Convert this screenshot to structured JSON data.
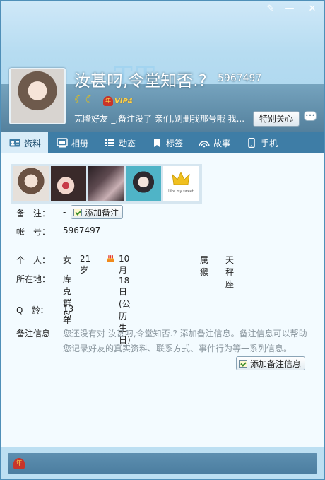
{
  "profile": {
    "nickname": "汝甚叼,令堂知否.?",
    "qq_number": "5967497",
    "header_decoration": "TT",
    "moons": "☾☾",
    "vip_label": "VIP4",
    "vip_badge": "年",
    "signature": "克隆好友-_,备注没了   亲们,别删我那号哦  我...",
    "special_care_label": "特别关心",
    "chat_icon": "chat-bubble-icon"
  },
  "window": {
    "skin_icon": "✎",
    "minimize_icon": "—",
    "close_icon": "✕"
  },
  "tabs": [
    {
      "label": "资料",
      "icon": "profile-card-icon"
    },
    {
      "label": "相册",
      "icon": "album-icon"
    },
    {
      "label": "动态",
      "icon": "list-icon"
    },
    {
      "label": "标签",
      "icon": "bookmark-icon"
    },
    {
      "label": "故事",
      "icon": "signal-icon"
    },
    {
      "label": "手机",
      "icon": "phone-icon"
    }
  ],
  "photo_strip": {
    "last_photo_text": "Like my sweet"
  },
  "info": {
    "remark_label": "备　注：",
    "remark_value": "-",
    "add_remark_button": "添加备注",
    "account_label": "帐　号：",
    "account_value": "5967497",
    "person_label": "个　人：",
    "gender": "女",
    "age": "21岁",
    "birthday": "10月18日(公历生日)",
    "zodiac": "属猴",
    "constellation": "天秤座",
    "location_label": "所在地：",
    "location_value": "库克群岛",
    "qage_label": "Q　龄：",
    "qage_value": "13年",
    "note_label": "备注信息",
    "note_text": "您还没有对 汝甚叼,令堂知否.? 添加备注信息。备注信息可以帮助您记录好友的真实资料、联系方式、事件行为等一系列信息。",
    "add_note_button": "添加备注信息"
  },
  "footer": {
    "badge_text": "年"
  },
  "colors": {
    "header_bg": "#b6dcf1",
    "tab_bar": "#3e7da6",
    "tab_active": "#d9ecf8",
    "content_bg": "#f3fbff",
    "vip_gold": "#ffd54a",
    "note_gray": "#8a969e"
  }
}
